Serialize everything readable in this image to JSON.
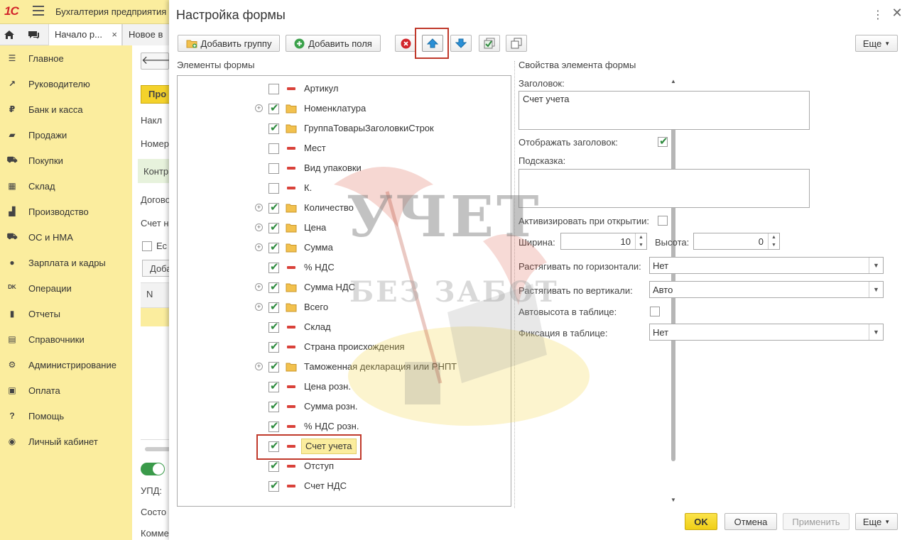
{
  "app": {
    "logo": "1С",
    "title": "Бухгалтерия предприятия",
    "tabs": [
      {
        "label": "Начало р...",
        "close": "×"
      },
      {
        "label": "Новое в"
      }
    ],
    "sidebar": [
      {
        "label": "Главное",
        "icon": "list-icon"
      },
      {
        "label": "Руководителю",
        "icon": "trend-icon"
      },
      {
        "label": "Банк и касса",
        "icon": "ruble-coin-icon"
      },
      {
        "label": "Продажи",
        "icon": "shopping-bag-icon"
      },
      {
        "label": "Покупки",
        "icon": "cart-icon"
      },
      {
        "label": "Склад",
        "icon": "warehouse-grid-icon"
      },
      {
        "label": "Производство",
        "icon": "factory-icon"
      },
      {
        "label": "ОС и НМА",
        "icon": "truck-icon"
      },
      {
        "label": "Зарплата и кадры",
        "icon": "person-icon"
      },
      {
        "label": "Операции",
        "icon": "dt-kt-icon"
      },
      {
        "label": "Отчеты",
        "icon": "bar-chart-icon"
      },
      {
        "label": "Справочники",
        "icon": "book-icon"
      },
      {
        "label": "Администрирование",
        "icon": "gear-icon"
      },
      {
        "label": "Оплата",
        "icon": "payment-icon"
      },
      {
        "label": "Помощь",
        "icon": "question-icon"
      },
      {
        "label": "Личный кабинет",
        "icon": "account-icon"
      }
    ],
    "content": {
      "button_partial": "Про",
      "line_1": "Накл",
      "line_2": "Номер",
      "line_3": "Контр",
      "line_4": "Догово",
      "line_5": "Счет н",
      "checkbox_label": "Ес",
      "add_button": "Доба",
      "col_header": "N",
      "footer_1": "УПД:",
      "footer_2": "Состо",
      "footer_3": "Комме"
    }
  },
  "dialog": {
    "title": "Настройка формы",
    "more_dots": "⋮",
    "close": "✕",
    "toolbar": {
      "add_group": "Добавить группу",
      "add_fields": "Добавить поля",
      "more": "Еще"
    },
    "left_header": "Элементы формы",
    "tree": [
      {
        "label": "Артикул",
        "checked": false,
        "kind": "field",
        "expandable": false
      },
      {
        "label": "Номенклатура",
        "checked": true,
        "kind": "group",
        "expandable": true
      },
      {
        "label": "ГруппаТоварыЗаголовкиСтрок",
        "checked": true,
        "kind": "group",
        "expandable": false
      },
      {
        "label": "Мест",
        "checked": false,
        "kind": "field",
        "expandable": false
      },
      {
        "label": "Вид упаковки",
        "checked": false,
        "kind": "field",
        "expandable": false
      },
      {
        "label": "К.",
        "checked": false,
        "kind": "field",
        "expandable": false
      },
      {
        "label": "Количество",
        "checked": true,
        "kind": "group",
        "expandable": true
      },
      {
        "label": "Цена",
        "checked": true,
        "kind": "group",
        "expandable": true
      },
      {
        "label": "Сумма",
        "checked": true,
        "kind": "group",
        "expandable": true
      },
      {
        "label": "% НДС",
        "checked": true,
        "kind": "field",
        "expandable": false
      },
      {
        "label": "Сумма НДС",
        "checked": true,
        "kind": "group",
        "expandable": true
      },
      {
        "label": "Всего",
        "checked": true,
        "kind": "group",
        "expandable": true
      },
      {
        "label": "Склад",
        "checked": true,
        "kind": "field",
        "expandable": false
      },
      {
        "label": "Страна происхождения",
        "checked": true,
        "kind": "field",
        "expandable": false
      },
      {
        "label": "Таможенная декларация или РНПТ",
        "checked": true,
        "kind": "group",
        "expandable": true
      },
      {
        "label": "Цена розн.",
        "checked": true,
        "kind": "field",
        "expandable": false
      },
      {
        "label": "Сумма розн.",
        "checked": true,
        "kind": "field",
        "expandable": false
      },
      {
        "label": "% НДС розн.",
        "checked": true,
        "kind": "field",
        "expandable": false
      },
      {
        "label": "Счет учета",
        "checked": true,
        "kind": "field",
        "expandable": false,
        "selected": true
      },
      {
        "label": "Отступ",
        "checked": true,
        "kind": "field",
        "expandable": false
      },
      {
        "label": "Счет НДС",
        "checked": true,
        "kind": "field",
        "expandable": false
      }
    ],
    "right_header": "Свойства элемента формы",
    "props": {
      "caption_label": "Заголовок:",
      "caption_value": "Счет учета",
      "show_caption_label": "Отображать заголовок:",
      "show_caption_checked": true,
      "hint_label": "Подсказка:",
      "hint_value": "",
      "activate_label": "Активизировать при открытии:",
      "activate_checked": false,
      "width_label": "Ширина:",
      "width_value": "10",
      "height_label": "Высота:",
      "height_value": "0",
      "stretch_h_label": "Растягивать по горизонтали:",
      "stretch_h_value": "Нет",
      "stretch_v_label": "Растягивать по вертикали:",
      "stretch_v_value": "Авто",
      "autoheight_label": "Автовысота в таблице:",
      "autoheight_checked": false,
      "fixation_label": "Фиксация в таблице:",
      "fixation_value": "Нет"
    },
    "footer": {
      "ok": "OK",
      "cancel": "Отмена",
      "apply": "Применить",
      "more": "Еще"
    }
  },
  "watermark": {
    "line_1": "УЧЕТ",
    "line_2": "БЕЗ ЗАБОТ"
  },
  "colors": {
    "accent_yellow": "#fbed9e",
    "ok_button": "#f0cf16",
    "highlight_frame": "#c0392b",
    "check_green": "#2e8b3e",
    "field_marker_red": "#d9423a",
    "folder_yellow": "#f2c14e"
  }
}
